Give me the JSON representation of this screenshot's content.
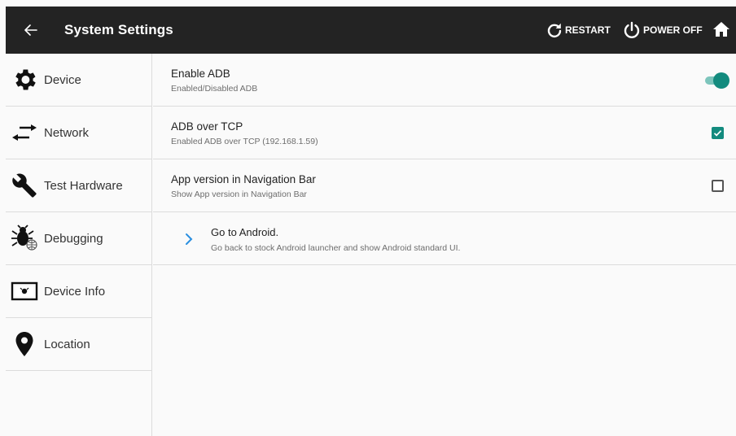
{
  "header": {
    "title": "System Settings",
    "restart_label": "RESTART",
    "power_off_label": "POWER OFF"
  },
  "sidebar": {
    "items": [
      {
        "label": "Device",
        "icon": "gear-icon"
      },
      {
        "label": "Network",
        "icon": "swap-arrows-icon"
      },
      {
        "label": "Test Hardware",
        "icon": "wrench-icon"
      },
      {
        "label": "Debugging",
        "icon": "bug-icon"
      },
      {
        "label": "Device Info",
        "icon": "device-screen-icon"
      },
      {
        "label": "Location",
        "icon": "location-pin-icon"
      }
    ]
  },
  "settings": {
    "rows": [
      {
        "title": "Enable ADB",
        "subtitle": "Enabled/Disabled ADB",
        "control": "toggle",
        "state": true
      },
      {
        "title": "ADB over TCP",
        "subtitle": "Enabled ADB over TCP (192.168.1.59)",
        "control": "checkbox",
        "state": true
      },
      {
        "title": "App version in Navigation Bar",
        "subtitle": "Show App version in Navigation Bar",
        "control": "checkbox",
        "state": false
      },
      {
        "title": "Go to Android.",
        "subtitle": "Go back to stock Android launcher and show Android standard UI.",
        "control": "chevron"
      }
    ]
  },
  "colors": {
    "topbar": "#232323",
    "accent": "#138b7e",
    "accent_track": "#7dc5bc",
    "chevron": "#2a8fe0"
  }
}
